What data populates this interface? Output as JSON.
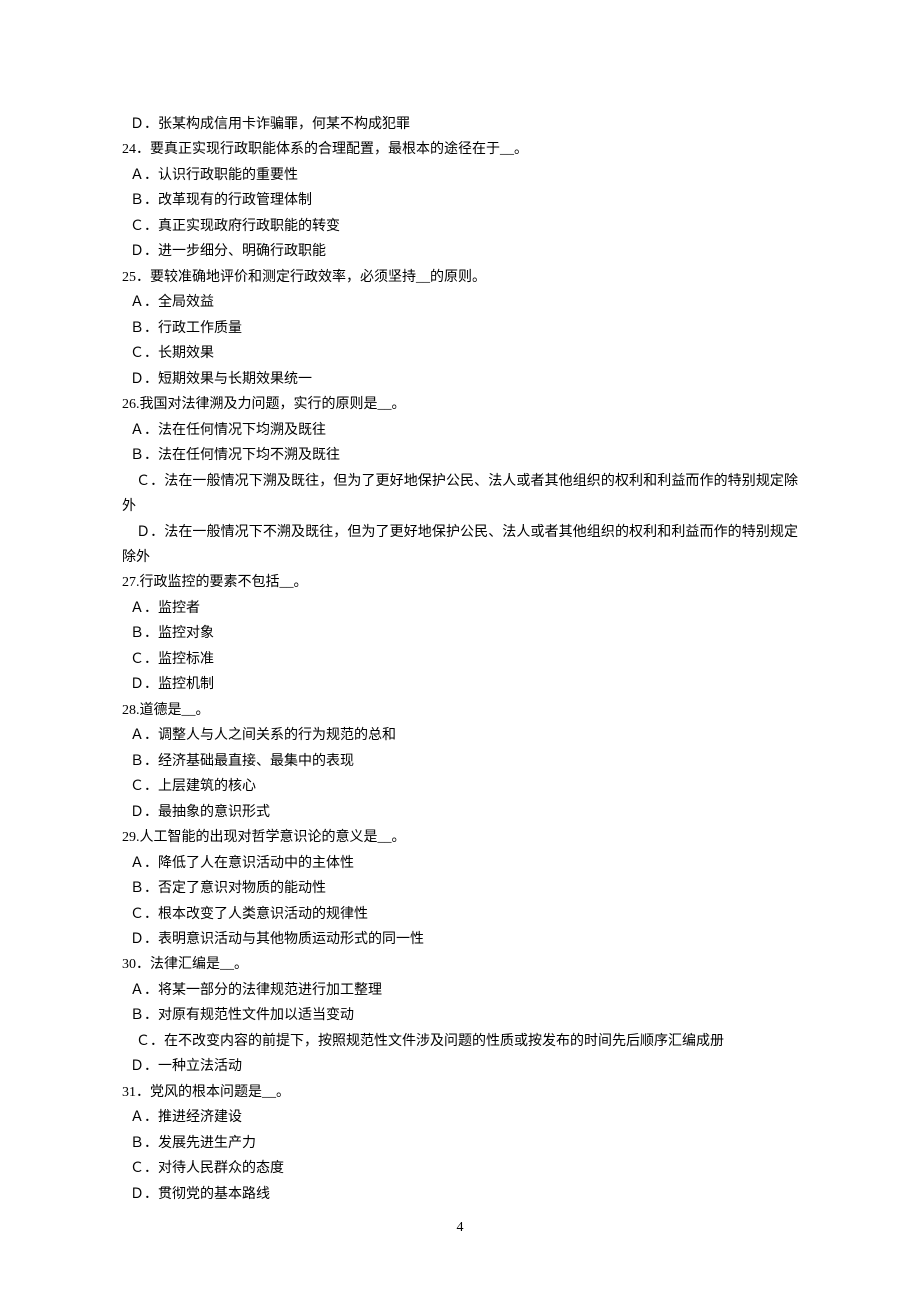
{
  "page_number": "4",
  "lines": [
    {
      "cls": "opt",
      "text": "Ｄ．张某构成信用卡诈骗罪，何某不构成犯罪"
    },
    {
      "cls": "",
      "text": "24．要真正实现行政职能体系的合理配置，最根本的途径在于__。"
    },
    {
      "cls": "opt",
      "text": "Ａ．认识行政职能的重要性"
    },
    {
      "cls": "opt",
      "text": "Ｂ．改革现有的行政管理体制"
    },
    {
      "cls": "opt",
      "text": "Ｃ．真正实现政府行政职能的转变"
    },
    {
      "cls": "opt",
      "text": "Ｄ．进一步细分、明确行政职能"
    },
    {
      "cls": "",
      "text": "25．要较准确地评价和测定行政效率，必须坚持__的原则。"
    },
    {
      "cls": "opt",
      "text": "Ａ．全局效益"
    },
    {
      "cls": "opt",
      "text": "Ｂ．行政工作质量"
    },
    {
      "cls": "opt",
      "text": "Ｃ．长期效果"
    },
    {
      "cls": "opt",
      "text": "Ｄ．短期效果与长期效果统一"
    },
    {
      "cls": "",
      "text": "26.我国对法律溯及力问题，实行的原则是__。"
    },
    {
      "cls": "opt",
      "text": "Ａ．法在任何情况下均溯及既往"
    },
    {
      "cls": "opt",
      "text": "Ｂ．法在任何情况下均不溯及既往"
    },
    {
      "cls": "",
      "text": "　Ｃ．法在一般情况下溯及既往，但为了更好地保护公民、法人或者其他组织的权利和利益而作的特别规定除外"
    },
    {
      "cls": "",
      "text": "　Ｄ．法在一般情况下不溯及既往，但为了更好地保护公民、法人或者其他组织的权利和利益而作的特别规定除外"
    },
    {
      "cls": "",
      "text": "27.行政监控的要素不包括__。"
    },
    {
      "cls": "opt",
      "text": "Ａ．监控者"
    },
    {
      "cls": "opt",
      "text": "Ｂ．监控对象"
    },
    {
      "cls": "opt",
      "text": "Ｃ．监控标准"
    },
    {
      "cls": "opt",
      "text": "Ｄ．监控机制"
    },
    {
      "cls": "",
      "text": "28.道德是__。"
    },
    {
      "cls": "opt",
      "text": "Ａ．调整人与人之间关系的行为规范的总和"
    },
    {
      "cls": "opt",
      "text": "Ｂ．经济基础最直接、最集中的表现"
    },
    {
      "cls": "opt",
      "text": "Ｃ．上层建筑的核心"
    },
    {
      "cls": "opt",
      "text": "Ｄ．最抽象的意识形式"
    },
    {
      "cls": "",
      "text": "29.人工智能的出现对哲学意识论的意义是__。"
    },
    {
      "cls": "opt",
      "text": "Ａ．降低了人在意识活动中的主体性"
    },
    {
      "cls": "opt",
      "text": "Ｂ．否定了意识对物质的能动性"
    },
    {
      "cls": "opt",
      "text": "Ｃ．根本改变了人类意识活动的规律性"
    },
    {
      "cls": "opt",
      "text": "Ｄ．表明意识活动与其他物质运动形式的同一性"
    },
    {
      "cls": "",
      "text": "30．法律汇编是__。"
    },
    {
      "cls": "opt",
      "text": "Ａ．将某一部分的法律规范进行加工整理"
    },
    {
      "cls": "opt",
      "text": "Ｂ．对原有规范性文件加以适当变动"
    },
    {
      "cls": "",
      "text": "　Ｃ．在不改变内容的前提下，按照规范性文件涉及问题的性质或按发布的时间先后顺序汇编成册"
    },
    {
      "cls": "opt",
      "text": "Ｄ．一种立法活动"
    },
    {
      "cls": "",
      "text": "31．党风的根本问题是__。"
    },
    {
      "cls": "opt",
      "text": "Ａ．推进经济建设"
    },
    {
      "cls": "opt",
      "text": "Ｂ．发展先进生产力"
    },
    {
      "cls": "opt",
      "text": "Ｃ．对待人民群众的态度"
    },
    {
      "cls": "opt",
      "text": "Ｄ．贯彻党的基本路线"
    }
  ]
}
